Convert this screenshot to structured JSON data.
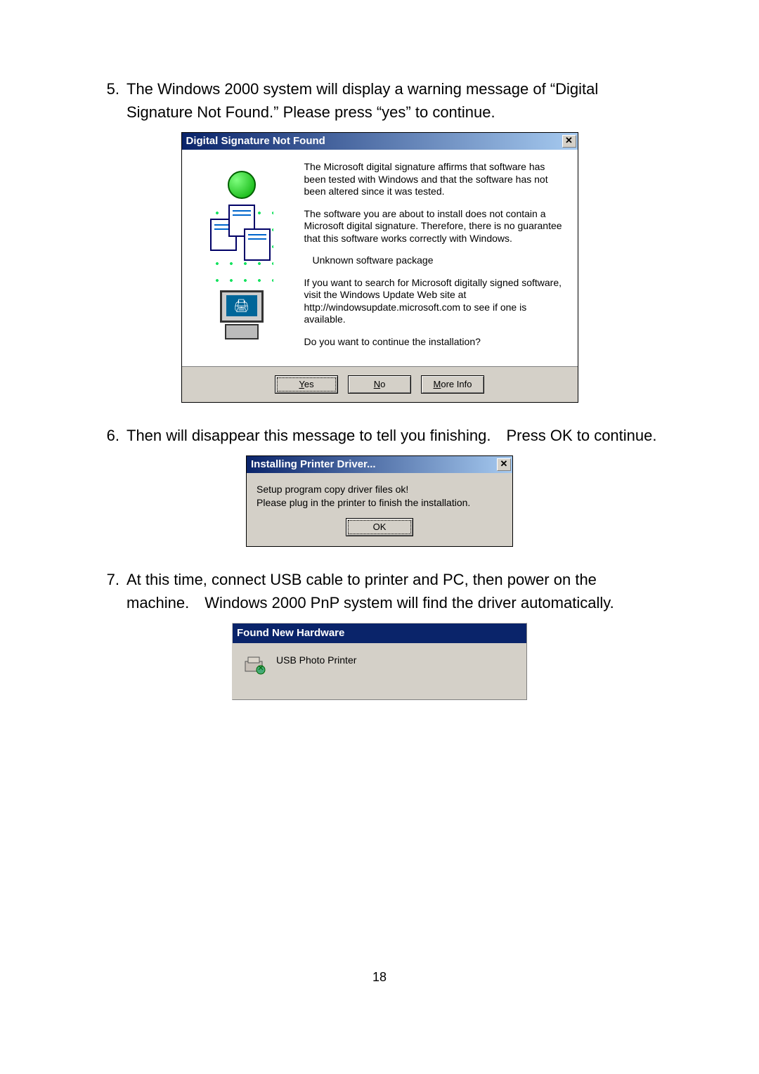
{
  "steps": {
    "s5": {
      "num": "5.",
      "text": "The Windows 2000 system will display a warning message of “Digital Signature Not Found.” Please press “yes” to continue."
    },
    "s6": {
      "num": "6.",
      "text": "Then will disappear this message to tell you finishing. Press OK to continue."
    },
    "s7": {
      "num": "7.",
      "text": "At this time, connect USB cable to printer and PC, then power on the machine. Windows 2000 PnP system will find the driver automatically."
    }
  },
  "dialog1": {
    "title": "Digital Signature Not Found",
    "p1": "The Microsoft digital signature affirms that software has been tested with Windows and that the software has not been altered since it was tested.",
    "p2": "The software you are about to install does not contain a Microsoft digital signature. Therefore, there is no guarantee that this software works correctly with Windows.",
    "p3": "Unknown software package",
    "p4": "If you want to search for Microsoft digitally signed software, visit the Windows Update Web site at http://windowsupdate.microsoft.com to see if one is available.",
    "p5": "Do you want to continue the installation?",
    "btn_yes_u": "Y",
    "btn_yes_rest": "es",
    "btn_no_u": "N",
    "btn_no_rest": "o",
    "btn_more_u": "M",
    "btn_more_rest": "ore Info",
    "close": "✕"
  },
  "dialog2": {
    "title": "Installing Printer Driver...",
    "line1": "Setup program copy driver files ok!",
    "line2": "Please plug in the printer to finish the installation.",
    "ok": "OK",
    "close": "✕"
  },
  "dialog3": {
    "title": "Found New Hardware",
    "device": "USB Photo Printer"
  },
  "page_number": "18",
  "icons": {
    "printer_glyph": "🖨"
  }
}
